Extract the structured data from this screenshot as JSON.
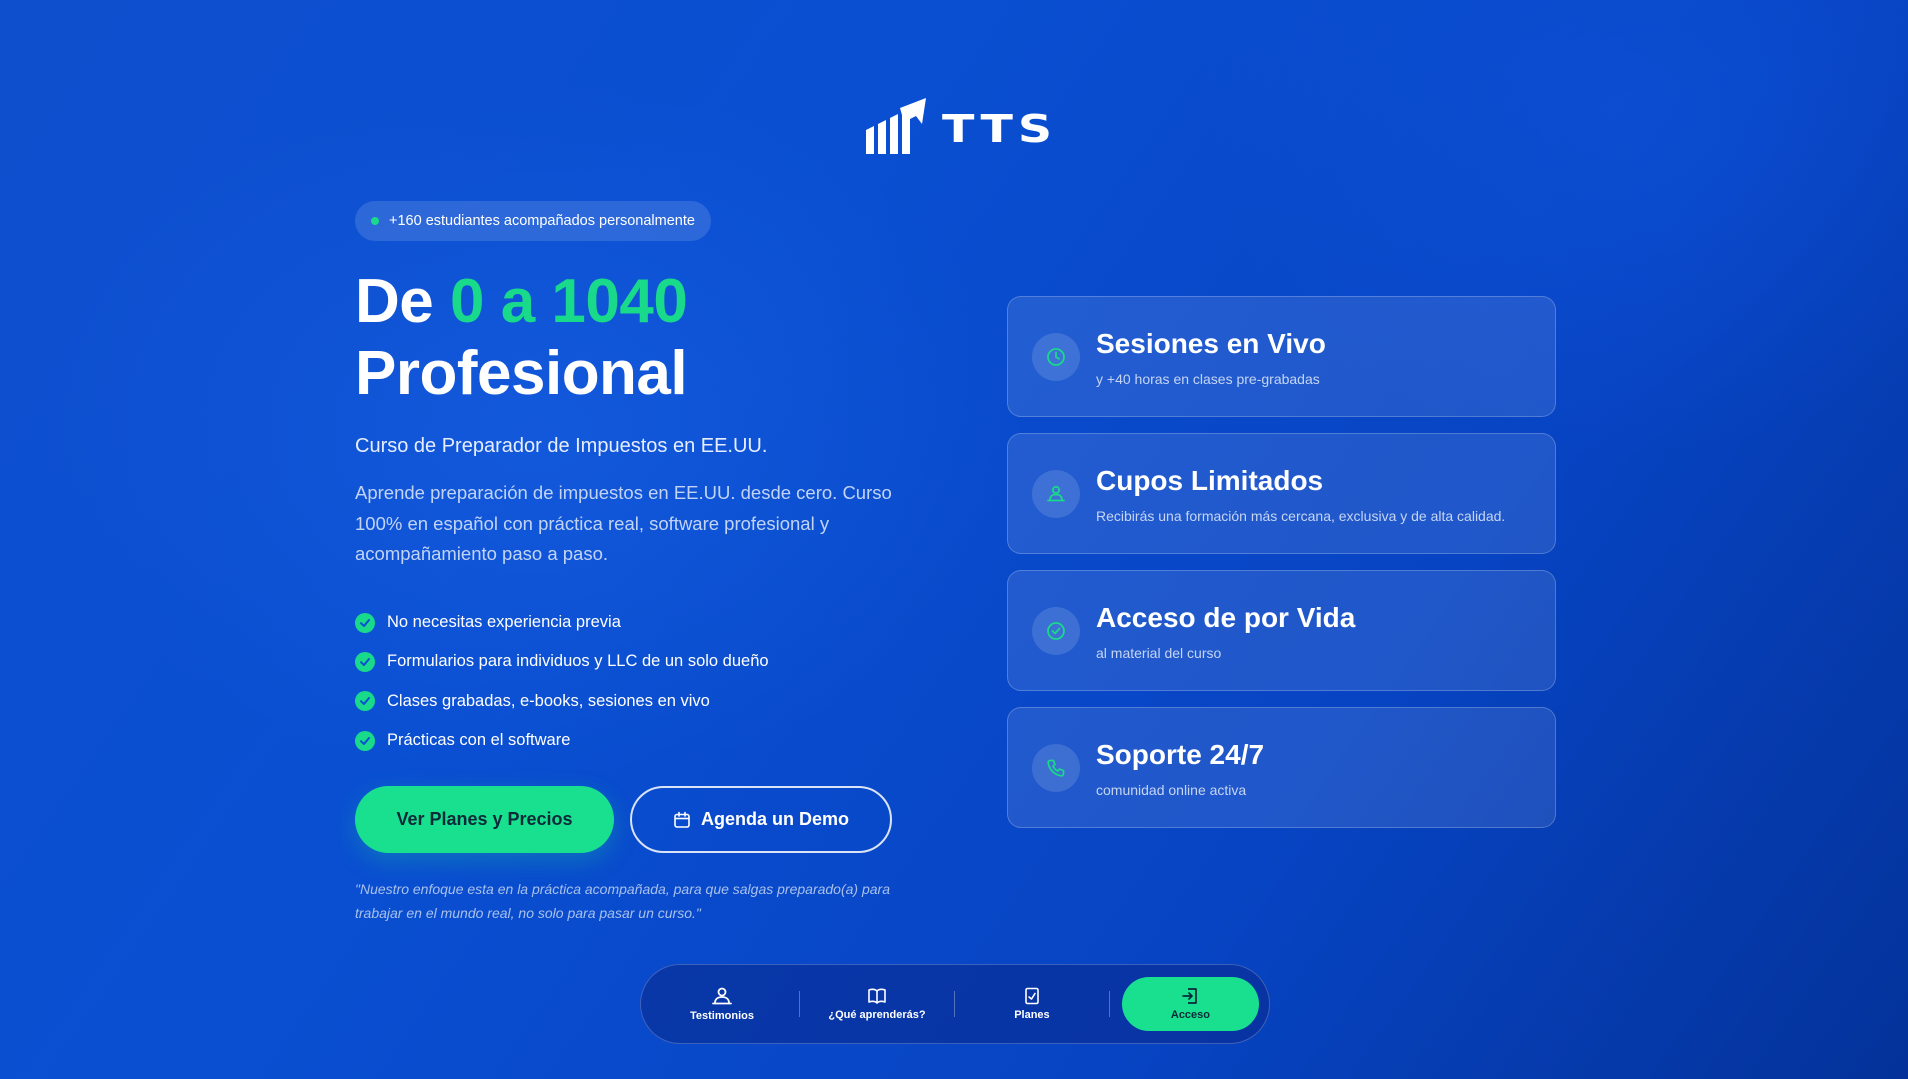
{
  "brand": {
    "name": "TTS"
  },
  "badge": {
    "text": "+160 estudiantes acompañados personalmente"
  },
  "hero": {
    "title_prefix": "De ",
    "title_accent": "0 a 1040",
    "title_line2": "Profesional",
    "subtitle": "Curso de Preparador de Impuestos en EE.UU.",
    "description": "Aprende preparación de impuestos en EE.UU. desde cero. Curso 100% en español con práctica real, software profesional y acompañamiento paso a paso.",
    "features": [
      "No necesitas experiencia previa",
      "Formularios para individuos y LLC de un solo dueño",
      "Clases grabadas, e-books, sesiones en vivo",
      "Prácticas con el software"
    ],
    "primary_button": "Ver Planes y Precios",
    "secondary_button": "Agenda un Demo",
    "quote": "\"Nuestro enfoque esta en la práctica acompañada, para que salgas preparado(a) para trabajar en el mundo real, no solo para pasar un curso.\""
  },
  "cards": [
    {
      "title": "Sesiones en Vivo",
      "subtitle": "y +40 horas en clases pre-grabadas",
      "icon": "clock-icon"
    },
    {
      "title": "Cupos Limitados",
      "subtitle": "Recibirás una formación más cercana, exclusiva y de alta calidad.",
      "icon": "user-group-icon"
    },
    {
      "title": "Acceso de por Vida",
      "subtitle": "al material del curso",
      "icon": "check-circle-icon"
    },
    {
      "title": "Soporte 24/7",
      "subtitle": "comunidad online activa",
      "icon": "phone-icon"
    }
  ],
  "bottom_nav": {
    "items": [
      {
        "label": "Testimonios",
        "icon": "users-icon"
      },
      {
        "label": "¿Qué aprenderás?",
        "icon": "book-icon"
      },
      {
        "label": "Planes",
        "icon": "receipt-icon"
      },
      {
        "label": "Acceso",
        "icon": "login-icon"
      }
    ]
  },
  "colors": {
    "accent": "#19d98a",
    "background": "#0a4fd2"
  }
}
